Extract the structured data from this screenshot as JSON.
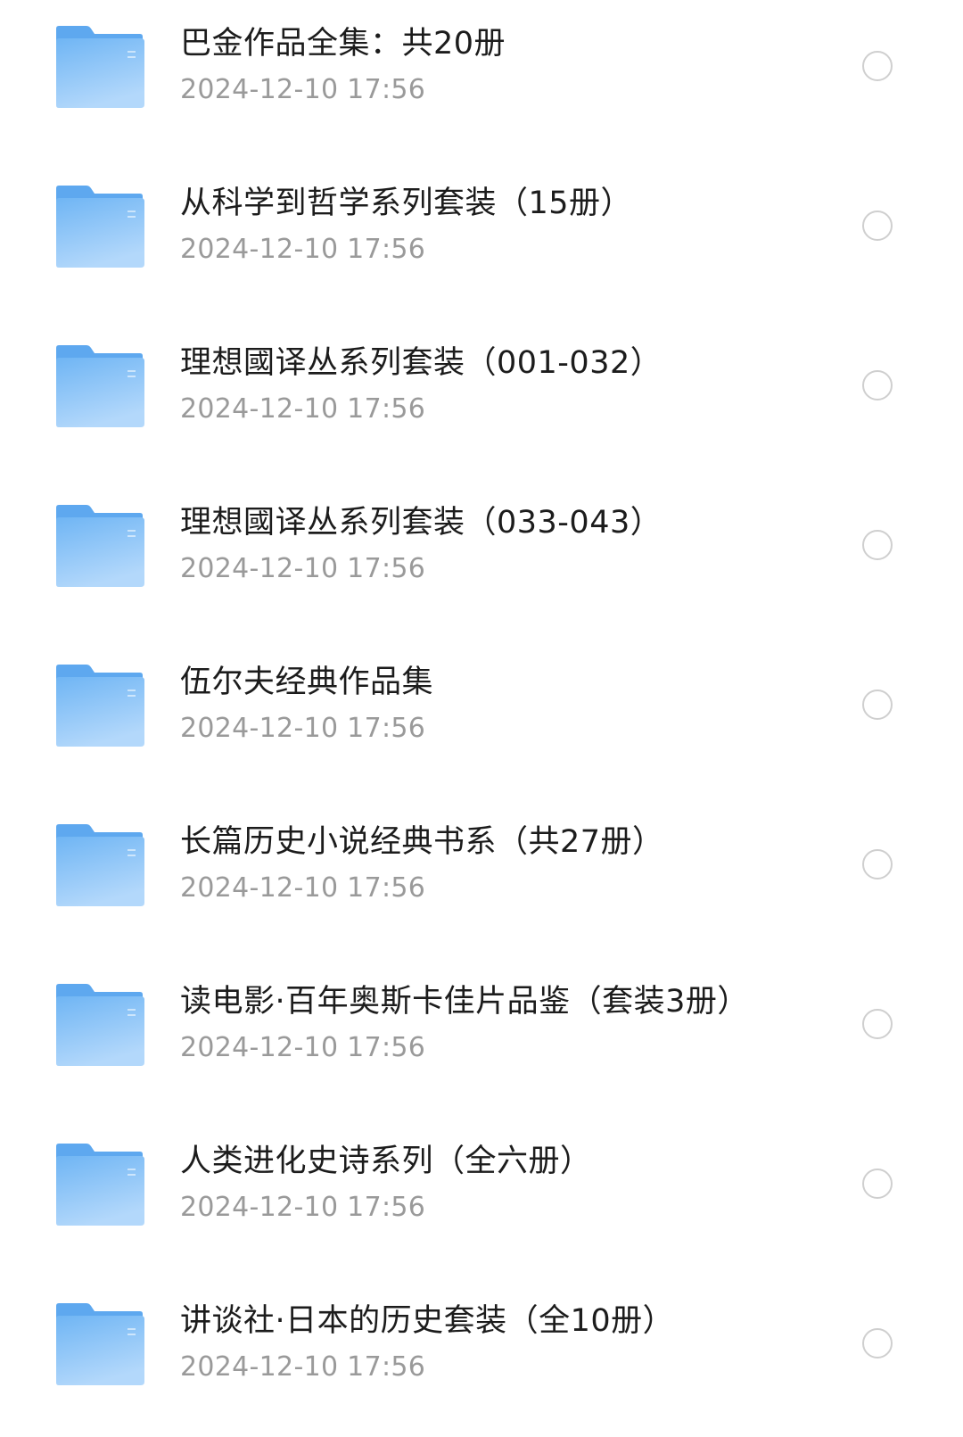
{
  "colors": {
    "folder_back": "#5ea8ef",
    "folder_front_top": "#6fb5f4",
    "folder_front_bottom": "#b3d8fb",
    "name_text": "#1c1c1c",
    "date_text": "#9a9a9a",
    "checkbox_border": "#cfcfcf"
  },
  "items": [
    {
      "name": "巴金作品全集：共20册",
      "date": "2024-12-10 17:56",
      "icon": "folder-icon",
      "selected": false
    },
    {
      "name": "从科学到哲学系列套装（15册）",
      "date": "2024-12-10 17:56",
      "icon": "folder-icon",
      "selected": false
    },
    {
      "name": "理想國译丛系列套装（001-032）",
      "date": "2024-12-10 17:56",
      "icon": "folder-icon",
      "selected": false
    },
    {
      "name": "理想國译丛系列套装（033-043）",
      "date": "2024-12-10 17:56",
      "icon": "folder-icon",
      "selected": false
    },
    {
      "name": "伍尔夫经典作品集",
      "date": "2024-12-10 17:56",
      "icon": "folder-icon",
      "selected": false
    },
    {
      "name": "长篇历史小说经典书系（共27册）",
      "date": "2024-12-10 17:56",
      "icon": "folder-icon",
      "selected": false
    },
    {
      "name": "读电影·百年奥斯卡佳片品鉴（套装3册）",
      "date": "2024-12-10 17:56",
      "icon": "folder-icon",
      "selected": false
    },
    {
      "name": "人类进化史诗系列（全六册）",
      "date": "2024-12-10 17:56",
      "icon": "folder-icon",
      "selected": false
    },
    {
      "name": "讲谈社·日本的历史套装（全10册）",
      "date": "2024-12-10 17:56",
      "icon": "folder-icon",
      "selected": false
    }
  ]
}
